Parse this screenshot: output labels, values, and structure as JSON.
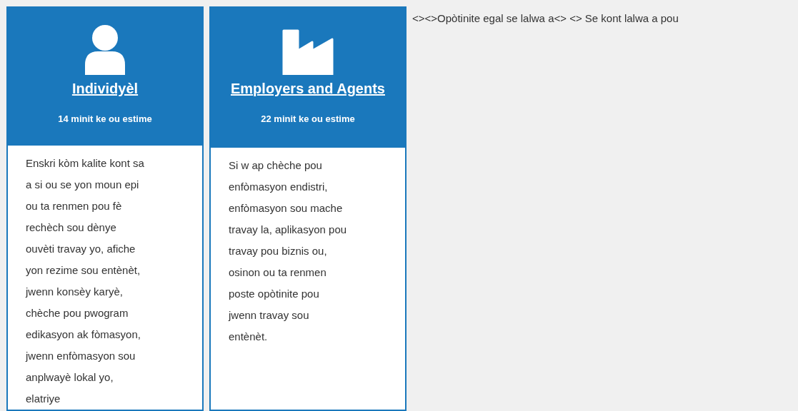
{
  "cards": [
    {
      "kind": "person",
      "title": "Individyèl",
      "estimate": "14 minit ke ou estime",
      "description_lines": [
        "Enskri kòm kalite kont sa",
        "a si ou se yon moun epi",
        "ou ta renmen pou fè",
        "rechèch sou dènye",
        "ouvèti travay yo, afiche",
        "yon rezime sou entènèt,",
        "jwenn konsèy karyè,",
        "chèche pou pwogram",
        "edikasyon ak fòmasyon,",
        "jwenn enfòmasyon sou",
        "anplwayè lokal yo,",
        "elatriye"
      ]
    },
    {
      "kind": "factory",
      "title": "Employers and Agents",
      "estimate": "22 minit ke ou estime",
      "description_lines": [
        "Si w ap chèche pou",
        "enfòmasyon endistri,",
        "enfòmasyon sou mache",
        "travay la, aplikasyon pou",
        "travay pou biznis ou,",
        "osinon ou ta renmen",
        "poste opòtinite pou",
        "jwenn travay sou",
        "entènèt."
      ]
    }
  ],
  "side_text": "<><>Opòtinite egal se lalwa a<> <> Se kont lalwa a pou"
}
